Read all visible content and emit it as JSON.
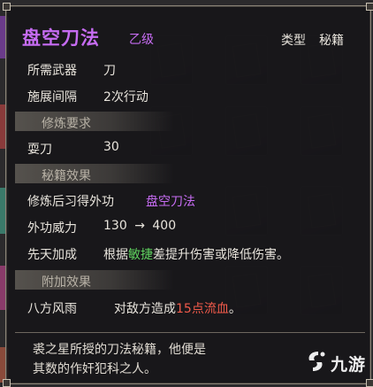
{
  "item": {
    "name": "盘空刀法",
    "grade": "乙级",
    "type_label": "类型",
    "type_value": "秘籍"
  },
  "stats": [
    {
      "label": "所需武器",
      "value": "刀"
    },
    {
      "label": "施展间隔",
      "value": "2次行动"
    }
  ],
  "requirements": {
    "header": "修炼要求",
    "items": [
      {
        "label": "耍刀",
        "value": "30"
      }
    ]
  },
  "book_effects": {
    "header": "秘籍效果",
    "learn_label": "修炼后习得外功",
    "learn_skill": "盘空刀法",
    "power_label": "外功威力",
    "power_from": "130",
    "power_arrow": "→",
    "power_to": "400",
    "innate_label": "先天加成",
    "innate_pre": "根据",
    "innate_stat": "敏捷",
    "innate_post": "差提升伤害或降低伤害。"
  },
  "extra_effects": {
    "header": "附加效果",
    "skill_name": "八方风雨",
    "desc_pre": "对敌方造成",
    "desc_highlight": "15点流血",
    "desc_post": "。"
  },
  "flavor_text": {
    "line1": "裘之星所授的刀法秘籍，他便是",
    "line2": "其数的作奸犯科之人。"
  },
  "watermark": {
    "text": "九游",
    "icon": "jiuyou-logo-icon"
  },
  "colors": {
    "purple": "#c66cf2",
    "green": "#5fd35f",
    "red": "#f05a4a"
  }
}
